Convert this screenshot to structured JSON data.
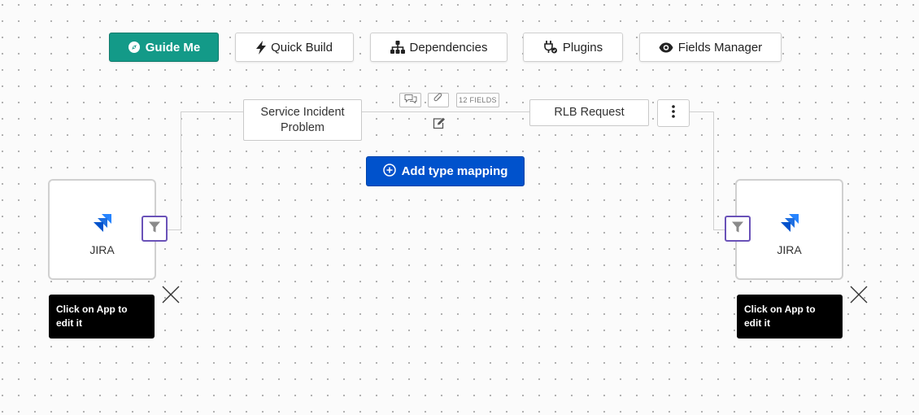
{
  "toolbar": {
    "guide_me": "Guide Me",
    "quick_build": "Quick Build",
    "dependencies": "Dependencies",
    "plugins": "Plugins",
    "fields_manager": "Fields Manager"
  },
  "mapping": {
    "source_type": "Service Incident Problem",
    "target_type": "RLB Request",
    "fields_count": "12 FIELDS",
    "add_button": "Add type mapping"
  },
  "apps": {
    "left": {
      "name": "JIRA",
      "tooltip": "Click on App to edit it"
    },
    "right": {
      "name": "JIRA",
      "tooltip": "Click on App to edit it"
    }
  },
  "colors": {
    "guide_me_bg": "#139a88",
    "add_button_bg": "#0052cc",
    "filter_border": "#6a52b8",
    "jira_blue": "#2684ff"
  },
  "icons": {
    "guide_me": "compass-icon",
    "quick_build": "lightning-icon",
    "dependencies": "sitemap-icon",
    "plugins": "plug-icon",
    "fields_manager": "eye-icon",
    "comments": "comments-icon",
    "attachment": "paperclip-icon",
    "edit": "edit-icon",
    "menu": "kebab-menu-icon",
    "add": "plus-circle-icon",
    "filter": "filter-icon",
    "app_logo": "jira-logo-icon",
    "close": "close-icon"
  }
}
